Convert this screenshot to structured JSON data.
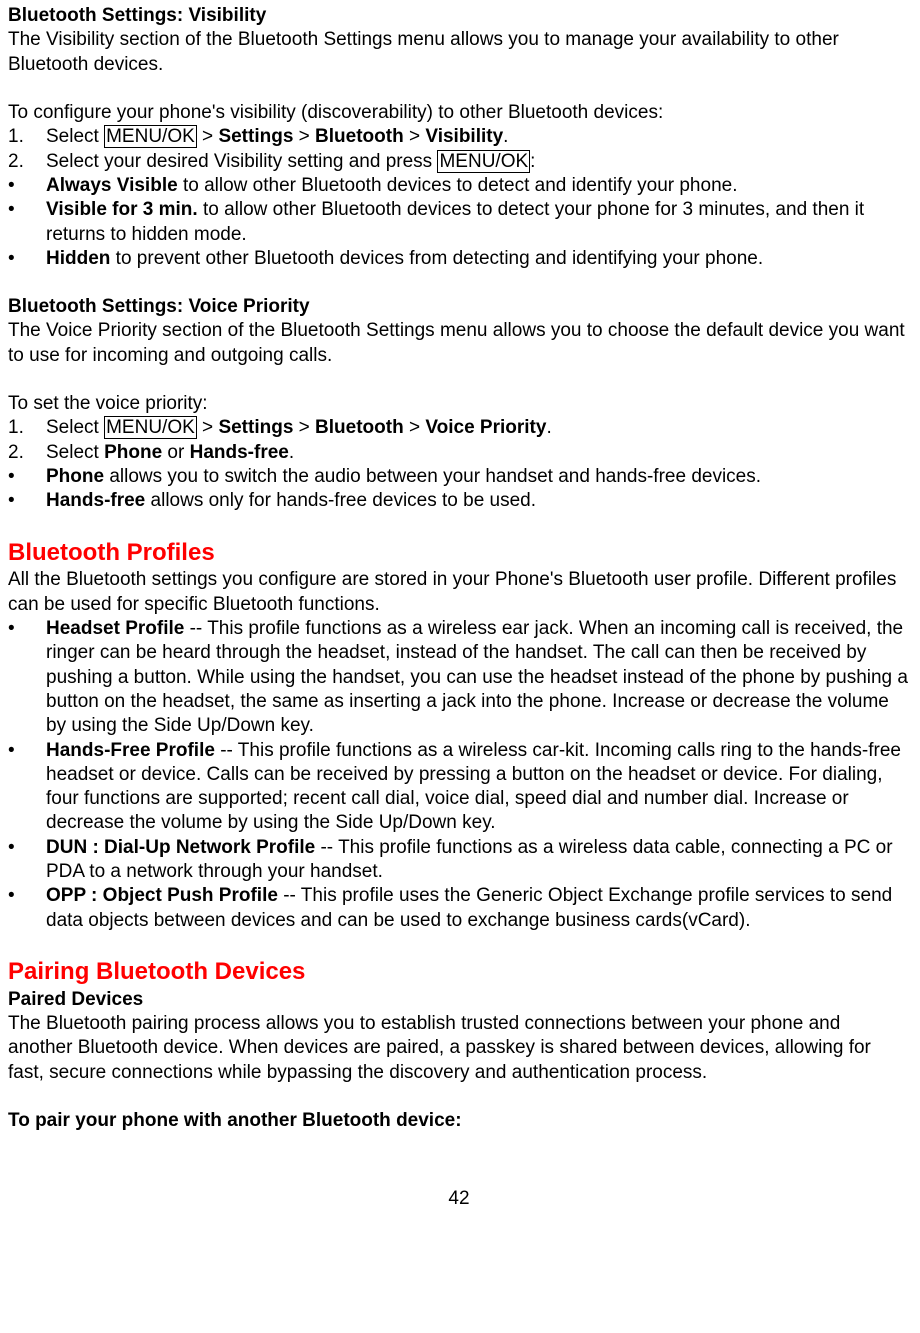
{
  "pageNumber": "42",
  "sec1": {
    "title": "Bluetooth Settings: Visibility",
    "intro": "The Visibility section of the Bluetooth Settings menu allows you to manage your availability to other Bluetooth devices.",
    "lead": "To configure your phone's visibility (discoverability) to other Bluetooth devices:",
    "step1_num": "1.",
    "step1_pre": "Select ",
    "step1_key": "MENU/OK",
    "step1_gt1": " > ",
    "step1_b1": "Settings",
    "step1_gt2": " > ",
    "step1_b2": "Bluetooth",
    "step1_gt3": " > ",
    "step1_b3": "Visibility",
    "step1_end": ".",
    "step2_num": "2.",
    "step2_pre": "Select your desired Visibility setting and press ",
    "step2_key": "MENU/OK",
    "step2_end": ":",
    "opt1_b": "Always Visible",
    "opt1_txt": " to allow other Bluetooth devices to detect and identify your phone.",
    "opt2_b": "Visible for 3 min.",
    "opt2_txt": " to allow other Bluetooth devices to detect your phone for 3 minutes, and then it returns to hidden mode.",
    "opt3_b": "Hidden",
    "opt3_txt": " to prevent other Bluetooth devices from detecting and identifying your phone."
  },
  "sec2": {
    "title": "Bluetooth Settings: Voice Priority",
    "intro": "The Voice Priority section of the Bluetooth Settings menu allows you to choose the default device you want to use for incoming and outgoing calls.",
    "lead": "To set the voice priority:",
    "step1_num": "1.",
    "step1_pre": "Select ",
    "step1_key": "MENU/OK",
    "step1_gt1": " > ",
    "step1_b1": "Settings",
    "step1_gt2": " > ",
    "step1_b2": "Bluetooth",
    "step1_gt3": " > ",
    "step1_b3": "Voice Priority",
    "step1_end": ".",
    "step2_num": "2.",
    "step2_pre": "Select ",
    "step2_b1": "Phone",
    "step2_or": " or ",
    "step2_b2": "Hands-free",
    "step2_end": ".",
    "opt1_b": "Phone",
    "opt1_txt": " allows you to switch the audio between your handset and hands-free devices.",
    "opt2_b": "Hands-free",
    "opt2_txt": " allows only for hands-free devices to be used."
  },
  "sec3": {
    "title": "Bluetooth Profiles",
    "intro": "All the Bluetooth settings you configure are stored in your Phone's Bluetooth user profile. Different profiles can be used for specific Bluetooth functions.",
    "opt1_b": "Headset Profile",
    "opt1_txt": " -- This profile functions as a wireless ear jack. When an incoming call is received, the ringer can be heard through the headset, instead of the handset. The call can then be received by pushing a button. While using the handset, you can use the headset instead of the phone by pushing a button on the headset, the same as inserting a jack into the phone. Increase or decrease the volume by using the Side Up/Down key.",
    "opt2_b": "Hands-Free Profile",
    "opt2_txt": " -- This profile functions as a wireless car-kit. Incoming calls ring to the hands-free headset or device. Calls can be received by pressing a button on the headset or device. For dialing, four functions are supported; recent call dial, voice dial, speed dial and number dial. Increase or decrease the volume by using the Side Up/Down key.",
    "opt3_b": "DUN : Dial-Up Network Profile",
    "opt3_txt": " -- This profile functions as a wireless data cable, connecting a PC or PDA to a network through your handset.",
    "opt4_b": "OPP : Object Push Profile",
    "opt4_txt": " -- This profile uses the Generic Object Exchange profile services to send data objects between devices and can be used to exchange business cards(vCard)."
  },
  "sec4": {
    "title": "Pairing Bluetooth Devices",
    "sub": "Paired Devices",
    "intro": "The Bluetooth pairing process allows you to establish trusted connections between your phone and another Bluetooth device. When devices are paired, a passkey is shared between devices, allowing for fast, secure connections while bypassing the discovery and authentication process.",
    "lead": "To pair your phone with another Bluetooth device:"
  }
}
